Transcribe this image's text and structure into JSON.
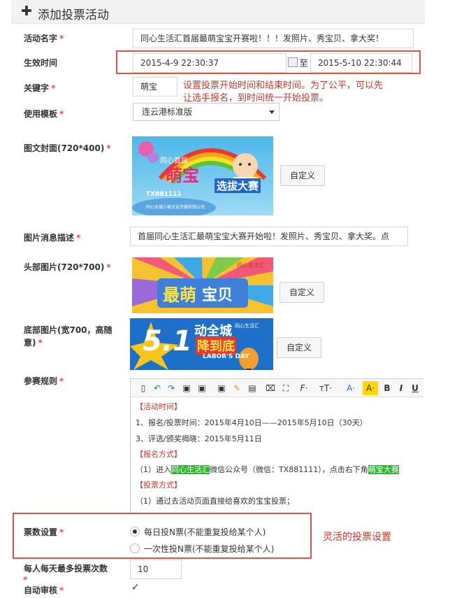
{
  "header": {
    "icon": "plus-icon",
    "title": "添加投票活动"
  },
  "fields": {
    "name": {
      "label": "活动名字",
      "required": "*",
      "value": "同心生活汇首届最萌宝宝开赛啦！！！发照片、秀宝贝、拿大奖！"
    },
    "effective_time": {
      "label": "生效时间",
      "start": "2015-4-9 22:30:37",
      "separator": "至",
      "end": "2015-5-10 22:30:44"
    },
    "keyword": {
      "label": "关键字",
      "required": "*",
      "value": "萌宝"
    },
    "template": {
      "label": "使用模板",
      "required": "*",
      "value": "连云港标准版"
    },
    "cover": {
      "label": "图文封面(720*400)",
      "required": "*",
      "button": "自定义"
    },
    "message_desc": {
      "label": "图片消息描述",
      "required": "*",
      "value": "首届同心生活汇最萌宝宝大赛开始啦！发照片、秀宝贝、拿大奖。点"
    },
    "header_image": {
      "label": "头部图片(720*700)",
      "required": "*",
      "button": "自定义"
    },
    "footer_image": {
      "label_line1": "底部图片(宽700，高随",
      "label_line2": "意)",
      "required": "*",
      "button": "自定义"
    },
    "rules": {
      "label": "参赛规则",
      "required": "*"
    },
    "vote_setting": {
      "label": "票数设置",
      "required": "*",
      "option1": "每日投N票(不能重复投给某个人)",
      "option2": "一次性投N票(不能重复投给某个人)"
    },
    "max_votes": {
      "label": "每人每天最多投票次数",
      "required": "*",
      "value": "10"
    },
    "auto_review": {
      "label": "自动审核",
      "required": "*",
      "check": "✓"
    }
  },
  "annotations": {
    "time_note_line1": "设置投票开始时间和结束时间。为了公平，可以先",
    "time_note_line2": "让选手报名，到时间统一开始投票。",
    "vote_note": "灵活的投票设置"
  },
  "images": {
    "cover": {
      "line1": "同心首届",
      "line2": "萌宝",
      "line3": "选拔大赛",
      "contact": "TX881111",
      "company": "同心天城小善文化传媒有限公司"
    },
    "header": {
      "text1": "最萌",
      "text2": "宝贝",
      "small": "同心生活汇"
    },
    "footer": {
      "big": "5.1",
      "t1": "动全城",
      "t2": "降到底",
      "t3": "LABOR'S DAY",
      "brand": "同心生活汇"
    }
  },
  "editor": {
    "toolbar": {
      "font": "F·",
      "size": "тT·",
      "a_color": "A·",
      "bg_color": "A·",
      "bold": "B",
      "italic": "I",
      "underline": "U"
    },
    "lines": [
      {
        "text": "【活动时间】"
      },
      {
        "text": "1、报名/投票时间：2015年4月10日——2015年5月10日（30天）"
      },
      {
        "text": "3、评选/颁奖揭晓：2015年5月11日"
      },
      {
        "text": "【报名方式】"
      },
      {
        "pre": "（1）进入",
        "hl1": "同心生活汇",
        "mid": "微信公众号（微信：TX881111），点击右下角",
        "hl2": "萌宝大赛"
      },
      {
        "text": "【投票方式】"
      },
      {
        "text": "（1）通过去活动页面直接给喜欢的宝宝投票；"
      }
    ]
  },
  "colors": {
    "required": "#d9534f",
    "annotation": "#c0392b",
    "highlight": "#2fb52f"
  }
}
